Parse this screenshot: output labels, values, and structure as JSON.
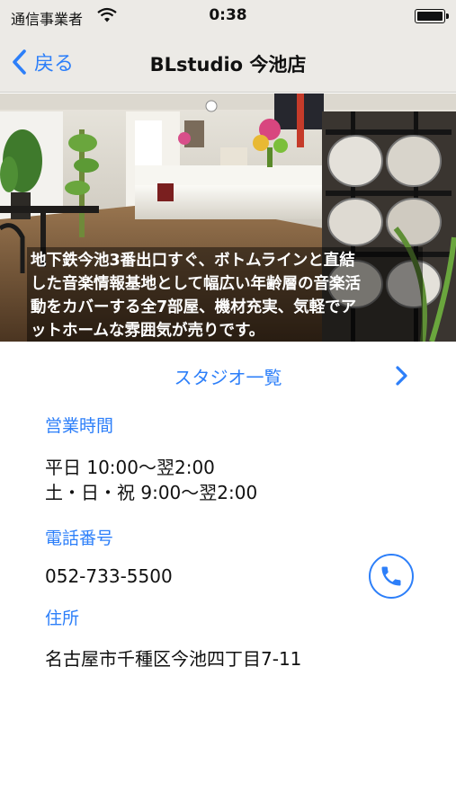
{
  "status_bar": {
    "carrier": "通信事業者",
    "time": "0:38",
    "wifi_icon": "wifi-icon",
    "battery_icon": "battery-icon"
  },
  "nav": {
    "back_label": "戻る",
    "title": "BLstudio 今池店"
  },
  "hero": {
    "caption_lines": [
      "地下鉄今池3番出口すぐ、ボトムラインと直結",
      "した音楽情報基地として幅広い年齢層の音楽活",
      "動をカバーする全7部屋、機材充実、気軽でア",
      "ットホームな雰囲気が売りです。"
    ]
  },
  "studio_list": {
    "label": "スタジオ一覧"
  },
  "hours": {
    "heading": "営業時間",
    "lines": [
      "平日 10:00〜翌2:00",
      "土・日・祝 9:00〜翌2:00"
    ]
  },
  "phone": {
    "heading": "電話番号",
    "number": "052-733-5500"
  },
  "address": {
    "heading": "住所",
    "value": "名古屋市千種区今池四丁目7-11"
  },
  "colors": {
    "accent": "#2d7ff9",
    "bar_background": "#eceae6"
  }
}
